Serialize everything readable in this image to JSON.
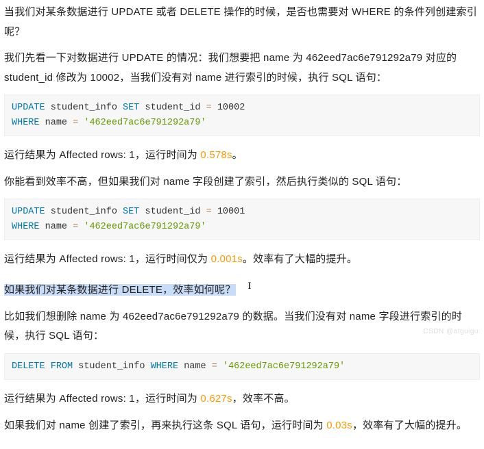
{
  "p1": "当我们对某条数据进行 UPDATE 或者 DELETE 操作的时候，是否也需要对 WHERE 的条件列创建索引呢？",
  "p2": "我们先看一下对数据进行 UPDATE 的情况：我们想要把 name 为 462eed7ac6e791292a79 对应的 student_id 修改为 10002，当我们没有对 name 进行索引的时候，执行 SQL 语句：",
  "code1": {
    "kw_update": "UPDATE",
    "tbl": "student_info",
    "kw_set": "SET",
    "col": "student_id",
    "op_eq1": "=",
    "val": "10002",
    "kw_where": "WHERE",
    "name_col": "name",
    "op_eq2": "=",
    "str": "'462eed7ac6e791292a79'"
  },
  "p3_a": "运行结果为 Affected rows: 1，运行时间为 ",
  "p3_time": "0.578s",
  "p3_b": "。",
  "p4": "你能看到效率不高，但如果我们对 name 字段创建了索引，然后执行类似的 SQL 语句：",
  "code2": {
    "kw_update": "UPDATE",
    "tbl": "student_info",
    "kw_set": "SET",
    "col": "student_id",
    "op_eq1": "=",
    "val": "10001",
    "kw_where": "WHERE",
    "name_col": "name",
    "op_eq2": "=",
    "str": "'462eed7ac6e791292a79'"
  },
  "p5_a": "运行结果为 Affected rows: 1，运行时间仅为 ",
  "p5_time": "0.001s",
  "p5_b": "。效率有了大幅的提升。",
  "p6_a": "如果我们对某条数据进行 DELETE，效率如何呢？",
  "p6_cursor": "I",
  "p7": "比如我们想删除 name 为 462eed7ac6e791292a79 的数据。当我们没有对 name 字段进行索引的时候，执行 SQL 语句：",
  "code3": {
    "kw_delete": "DELETE",
    "kw_from": "FROM",
    "tbl": "student_info",
    "kw_where": "WHERE",
    "name_col": "name",
    "op_eq": "=",
    "str": "'462eed7ac6e791292a79'"
  },
  "p8_a": "运行结果为 Affected rows: 1，运行时间为 ",
  "p8_time": "0.627s",
  "p8_b": "，效率不高。",
  "p9_a": "如果我们对 name 创建了索引，再来执行这条 SQL 语句，运行时间为 ",
  "p9_time": "0.03s",
  "p9_b": "，效率有了大幅的提升。",
  "watermark": "CSDN @atguigu"
}
